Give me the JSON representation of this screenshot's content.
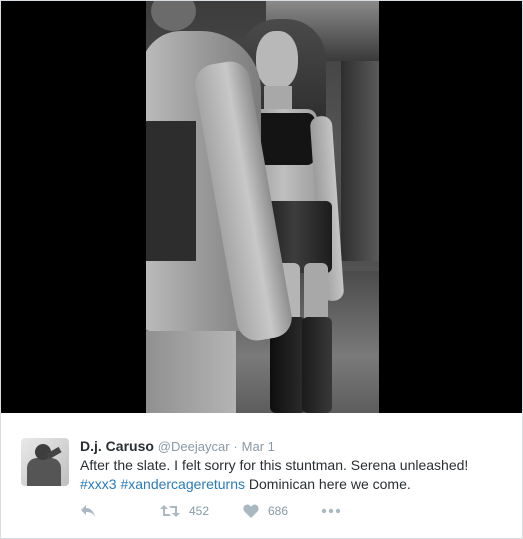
{
  "tweet": {
    "author": {
      "display_name": "D.j. Caruso",
      "handle": "@Deejaycar"
    },
    "separator": "·",
    "date": "Mar 1",
    "text_plain": "After the slate. I felt sorry for this stuntman. Serena unleashed!",
    "hashtags": [
      "#xxx3",
      "#xandercagereturns"
    ],
    "text_tail": "Dominican here we come.",
    "actions": {
      "reply": {
        "icon": "reply-icon"
      },
      "retweet": {
        "icon": "retweet-icon",
        "count": "452"
      },
      "like": {
        "icon": "heart-icon",
        "count": "686"
      },
      "more": {
        "icon": "more-icon"
      }
    }
  },
  "colors": {
    "hashtag": "#2b7bb9",
    "meta": "#8899a6",
    "text": "#292f33",
    "media_bg": "#000000"
  }
}
